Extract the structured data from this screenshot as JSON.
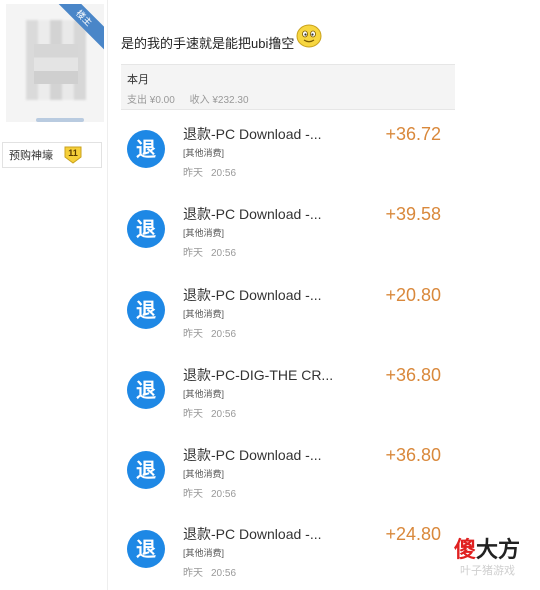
{
  "sidebar": {
    "ribbon_text": "楼主",
    "badge": {
      "name": "预购神壕",
      "level": "11"
    }
  },
  "post": {
    "text": "是的我的手速就是能把ubi撸空"
  },
  "month": {
    "title": "本月",
    "expense": "支出 ¥0.00",
    "income": "收入 ¥232.30"
  },
  "transactions": [
    {
      "icon": "退",
      "title": "退款-PC Download -...",
      "category": "[其他消费]",
      "day": "昨天",
      "time": "20:56",
      "amount": "+36.72"
    },
    {
      "icon": "退",
      "title": "退款-PC Download -...",
      "category": "[其他消费]",
      "day": "昨天",
      "time": "20:56",
      "amount": "+39.58"
    },
    {
      "icon": "退",
      "title": "退款-PC Download -...",
      "category": "[其他消费]",
      "day": "昨天",
      "time": "20:56",
      "amount": "+20.80"
    },
    {
      "icon": "退",
      "title": "退款-PC-DIG-THE CR...",
      "category": "[其他消费]",
      "day": "昨天",
      "time": "20:56",
      "amount": "+36.80"
    },
    {
      "icon": "退",
      "title": "退款-PC Download -...",
      "category": "[其他消费]",
      "day": "昨天",
      "time": "20:56",
      "amount": "+36.80"
    },
    {
      "icon": "退",
      "title": "退款-PC Download -...",
      "category": "[其他消费]",
      "day": "昨天",
      "time": "20:56",
      "amount": "+24.80"
    }
  ],
  "watermark": {
    "part1": "傻",
    "part2": "大方",
    "sub": "叶子猪游戏"
  },
  "colors": {
    "accent_blue": "#1e88e5",
    "amount_orange": "#d9883b",
    "watermark_red": "#e02020"
  }
}
